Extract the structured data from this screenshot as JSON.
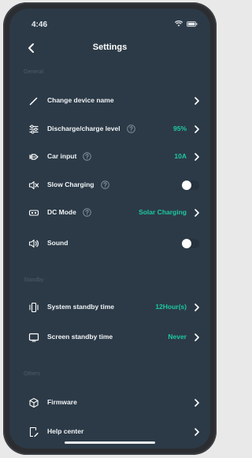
{
  "status_bar": {
    "time": "4:46"
  },
  "header": {
    "title": "Settings"
  },
  "sections": [
    {
      "label": "General"
    },
    {
      "label": "Standby"
    },
    {
      "label": "Others"
    }
  ],
  "rows": {
    "change_device_name": {
      "label": "Change device name",
      "icon": "pencil-icon"
    },
    "discharge_charge_level": {
      "label": "Discharge/charge level",
      "value": "95%",
      "icon": "sliders-icon"
    },
    "car_input": {
      "label": "Car input",
      "value": "10A",
      "icon": "car-plug-icon"
    },
    "slow_charging": {
      "label": "Slow Charging",
      "toggle": false,
      "icon": "speaker-mute-icon"
    },
    "dc_mode": {
      "label": "DC Mode",
      "value": "Solar Charging",
      "icon": "dc-port-icon"
    },
    "sound": {
      "label": "Sound",
      "toggle": false,
      "icon": "speaker-icon"
    },
    "system_standby_time": {
      "label": "System standby time",
      "value": "12Hour(s)",
      "icon": "phone-vibrate-icon"
    },
    "screen_standby_time": {
      "label": "Screen standby time",
      "value": "Never",
      "icon": "screen-icon"
    },
    "firmware": {
      "label": "Firmware",
      "icon": "cube-icon"
    },
    "help_center": {
      "label": "Help center",
      "icon": "help-doc-icon"
    }
  },
  "colors": {
    "background": "#2c3a47",
    "accent": "#1ec8a0",
    "text": "#f0f3f6",
    "section_label": "#4d5c6b"
  }
}
